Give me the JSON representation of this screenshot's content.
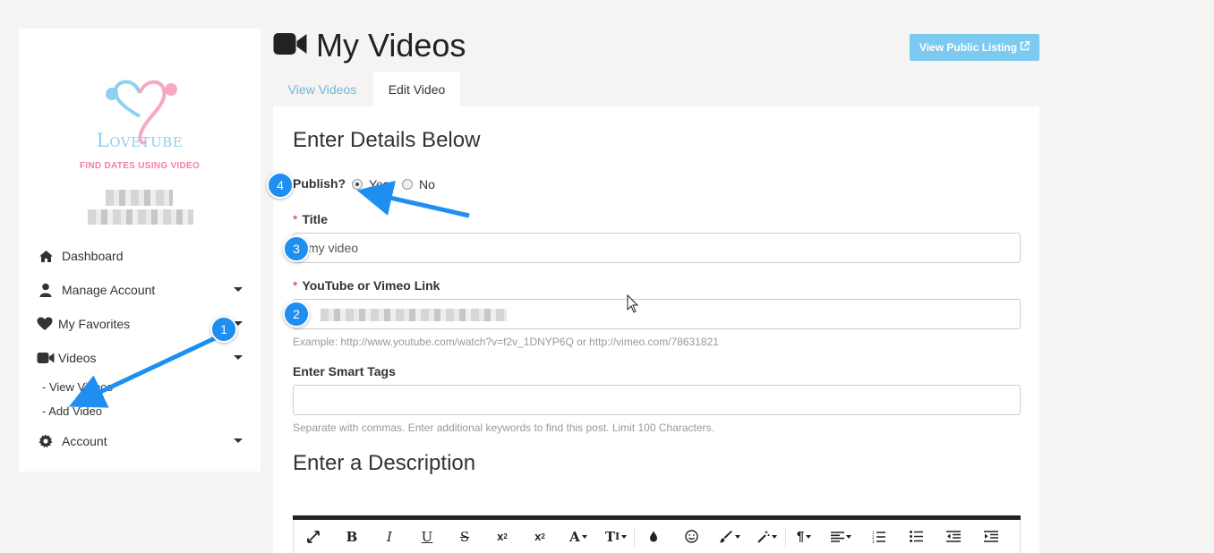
{
  "brand": {
    "name": "Lovetube",
    "tagline": "FIND DATES USING VIDEO"
  },
  "sidebar": {
    "items": [
      {
        "label": "Dashboard",
        "icon": "home-icon"
      },
      {
        "label": "Manage Account",
        "icon": "user-icon"
      },
      {
        "label": "My Favorites",
        "icon": "heart-icon"
      },
      {
        "label": "Videos",
        "icon": "video-camera-icon"
      },
      {
        "label": "Account",
        "icon": "gear-icon"
      }
    ],
    "video_sub": [
      "- View Videos",
      "- Add Video"
    ]
  },
  "header": {
    "title": "My Videos",
    "public_button": "View Public Listing"
  },
  "tabs": [
    "View Videos",
    "Edit Video"
  ],
  "form": {
    "heading": "Enter Details Below",
    "publish_label": "Publish?",
    "publish_yes": "Yes",
    "publish_no": "No",
    "publish_selected": "Yes",
    "title_label": "Title",
    "title_value": "my video",
    "link_label": "YouTube or Vimeo Link",
    "link_help": "Example: http://www.youtube.com/watch?v=f2v_1DNYP6Q or http://vimeo.com/78631821",
    "tags_label": "Enter Smart Tags",
    "tags_value": "",
    "tags_help": "Separate with commas. Enter additional keywords to find this post. Limit 100 Characters.",
    "desc_heading": "Enter a Description",
    "required_mark": "*"
  },
  "toolbar": [
    "fullscreen",
    "bold",
    "italic",
    "underline",
    "strikethrough",
    "subscript",
    "superscript",
    "font-family",
    "font-size",
    "color",
    "emoji",
    "paint-format",
    "clear-format",
    "paragraph",
    "align",
    "ordered-list",
    "unordered-list",
    "outdent",
    "indent"
  ],
  "annotations": [
    "1",
    "2",
    "3",
    "4"
  ],
  "colors": {
    "accent": "#1e8ff0",
    "link": "#6cb6df",
    "button": "#7ccaf0",
    "required": "#c9302c"
  }
}
